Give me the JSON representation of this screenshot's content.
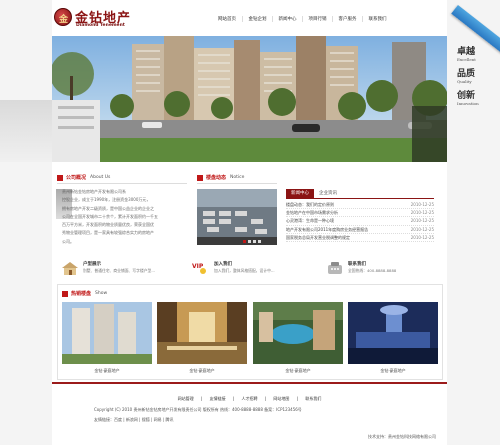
{
  "header": {
    "logo_mark": "金",
    "logo_cn": "金钻地产",
    "logo_en": "Diamond Tenement",
    "corner_ribbon": "",
    "nav": [
      "网站首页",
      "金钻企划",
      "新闻中心",
      "项目行销",
      "客户服务",
      "联系我们"
    ]
  },
  "slogans": [
    {
      "cn": "卓越",
      "en": "Excellent"
    },
    {
      "cn": "品质",
      "en": "Quality"
    },
    {
      "cn": "创新",
      "en": "Innovation"
    }
  ],
  "about": {
    "title_cn": "公司概况",
    "title_en": "About Us",
    "lines": [
      "贵州新钻金钻房地产开发有限公司系",
      "控股企业，成立于1990年，注册资金3000万元，",
      "拥有房地产开发二级资质，是中国公益企业的企业之",
      "公司在全国开发城市二十余个，累计开发面积约一千五",
      "百万平方米，开发面积的物业质量优良，荣获全国优",
      "秀物业管理项目，是一家具有较强综合实力的房地产",
      "公司。"
    ]
  },
  "news": {
    "title_cn": "楼盘动态",
    "title_en": "Notice",
    "tabs": [
      "新闻中心",
      "企业资讯"
    ],
    "items": [
      {
        "title": "楼盘动态：我们的定价原则",
        "date": "2010-12-25"
      },
      {
        "title": "金钻地产在中国市场需求分析",
        "date": "2010-12-25"
      },
      {
        "title": "心灵港湾：生命是一种心境",
        "date": "2010-12-25"
      },
      {
        "title": "地产开发有限公司2011年度购房业务经营报告",
        "date": "2010-12-25"
      },
      {
        "title": "国家税务总局开发营业税调整的规定",
        "date": "2010-12-25"
      }
    ]
  },
  "services": [
    {
      "title": "户型展示",
      "desc": "别墅、普通住宅、商业铺面、写字楼户型..."
    },
    {
      "title": "加入我们",
      "desc": "加入我们，整体风格搭配，设计中..."
    },
    {
      "title": "联系我们",
      "desc": "全国热线：400-8888-8888"
    }
  ],
  "hot": {
    "title_cn": "热销楼盘",
    "title_en": "Show",
    "captions": [
      "金钻·豪庭地产",
      "金钻·豪庭地产",
      "金钻·豪庭地产",
      "金钻·豪庭地产"
    ]
  },
  "footer": {
    "links": [
      "网站管理",
      "|",
      "友情链接",
      "|",
      "人才招聘",
      "|",
      "网站地图",
      "|",
      "联系我们"
    ],
    "copyright": "Copyright (C) 2010  贵州新钻金钻房地产开发有限责任公司  版权所有  热线：400-8888-8888  备案：ICP123456号",
    "friend_links": "友情链接：百度  |  新浪网  |  搜狐  |  网易  |  腾讯",
    "tech_support": "技术支持：贵州金钻科技网络有限公司"
  },
  "colors": {
    "brand": "#8b1414",
    "accent": "#c01818"
  }
}
